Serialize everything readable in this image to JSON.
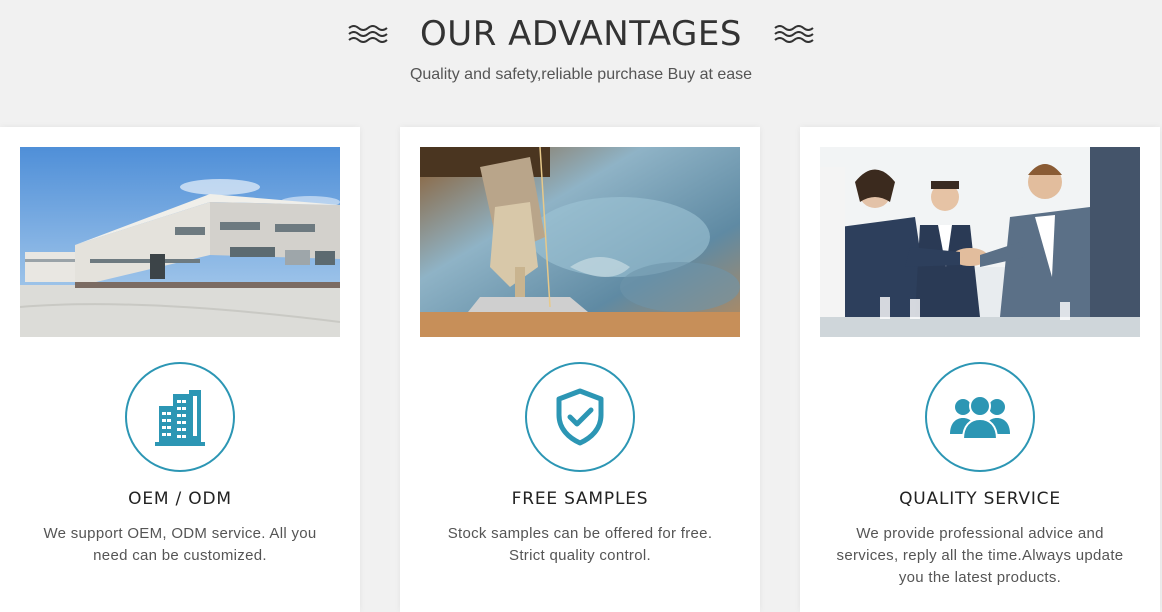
{
  "header": {
    "title": "OUR ADVANTAGES",
    "subtitle": "Quality and safety,reliable purchase Buy at ease"
  },
  "theme": {
    "accent": "#2c96b4",
    "title_color": "#333333",
    "background": "#f1f1f1"
  },
  "cards": [
    {
      "image": "factory-building-photo",
      "icon": "building-icon",
      "title": "OEM / ODM",
      "description": "We support OEM, ODM service. All you need can be customized."
    },
    {
      "image": "sewing-machine-photo",
      "icon": "shield-check-icon",
      "title": "FREE SAMPLES",
      "description": "Stock samples can be offered for free. Strict quality control."
    },
    {
      "image": "business-handshake-photo",
      "icon": "users-group-icon",
      "title": "QUALITY SERVICE",
      "description": "We provide professional advice and services, reply all the time.Always update you the latest products."
    }
  ]
}
